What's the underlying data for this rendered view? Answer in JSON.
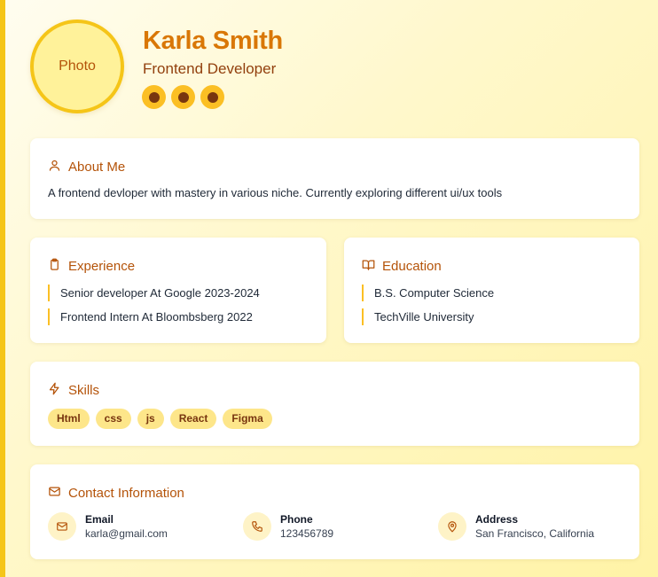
{
  "profile": {
    "avatar_text": "Photo",
    "name": "Karla Smith",
    "role": "Frontend Developer",
    "social_icons": [
      "social-link-1",
      "social-link-2",
      "social-link-3"
    ]
  },
  "about": {
    "title": "About Me",
    "icon": "user-icon",
    "text": "A frontend devloper with mastery in various niche. Currently exploring different ui/ux tools"
  },
  "experience": {
    "title": "Experience",
    "icon": "clipboard-icon",
    "items": [
      "Senior developer At Google 2023-2024",
      "Frontend Intern At Bloombsberg 2022"
    ]
  },
  "education": {
    "title": "Education",
    "icon": "book-icon",
    "items": [
      "B.S. Computer Science",
      "TechVille University"
    ]
  },
  "skills": {
    "title": "Skills",
    "icon": "zap-icon",
    "tags": [
      "Html",
      "css",
      "js",
      "React",
      "Figma"
    ]
  },
  "contact": {
    "title": "Contact Information",
    "icon": "mail-icon",
    "items": [
      {
        "label": "Email",
        "value": "karla@gmail.com",
        "icon": "mail-icon"
      },
      {
        "label": "Phone",
        "value": "123456789",
        "icon": "phone-icon"
      },
      {
        "label": "Address",
        "value": "San Francisco, California",
        "icon": "map-pin-icon"
      }
    ]
  },
  "colors": {
    "accent": "#d97706",
    "heading": "#b45309",
    "yellow": "#f5c518",
    "tag_bg": "#fde68a"
  }
}
